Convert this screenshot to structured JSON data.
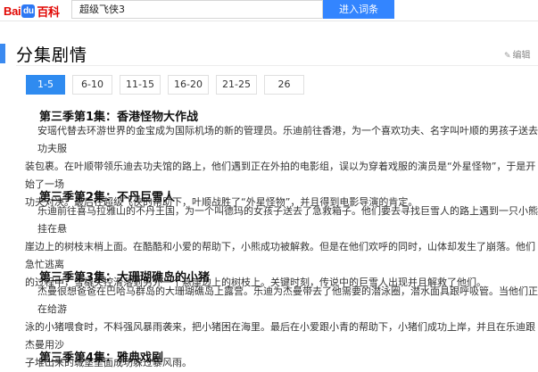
{
  "topbar": {
    "logo_bai": "Bai",
    "logo_paw": "du",
    "logo_baike": "百科",
    "search_value": "超级飞侠3",
    "search_button": "进入词条"
  },
  "section": {
    "title": "分集剧情",
    "edit_label": "编辑"
  },
  "tabs": [
    {
      "label": "1-5",
      "active": true
    },
    {
      "label": "6-10",
      "active": false
    },
    {
      "label": "11-15",
      "active": false
    },
    {
      "label": "16-20",
      "active": false
    },
    {
      "label": "21-25",
      "active": false
    },
    {
      "label": "26",
      "active": false
    }
  ],
  "episodes": [
    {
      "title": "第三季第1集：香港怪物大作战",
      "lines": [
        "安瑶代替去环游世界的金宝成为国际机场的新的管理员。乐迪前往香港，为一个喜欢功夫、名字叫叶顺的男孩子送去功夫服",
        "装包裹。在叶顺带领乐迪去功夫馆的路上，他们遇到正在外拍的电影组，误以为穿着戏服的演员是“外星怪物”，于是开始了一场",
        "功夫对决。最后在超级飞侠的帮助下，叶顺战胜了“外星怪物”，并且得到电影导演的肯定。"
      ]
    },
    {
      "title": "第三季第2集：不丹巨雪人",
      "lines": [
        "乐迪前往喜马拉雅山的不丹王国，为一个叫德玛的女孩子送去了急救箱子。他们要去寻找巨雪人的路上遇到一只小熊挂在悬",
        "崖边上的树枝末梢上面。在酷酷和小爱的帮助下，小熊成功被解救。但是在他们欢呼的同时，山体却发生了崩落。他们急忙逃离",
        "的过程中，雪橇失控滑落到另外一个悬崖边上的树枝上。关键时刻，传说中的巨雪人出现并且解救了他们。"
      ]
    },
    {
      "title": "第三季第3集：大珊瑚礁岛的小猪",
      "lines": [
        "杰曼很想爸爸在巴哈马群岛的大珊瑚礁岛上露营。乐迪为杰曼带去了他需要的潜泳圈，潜水面具跟呼吸管。当他们正在给游",
        "泳的小猪喂食时，不料强风暴雨袭来，把小猪困在海里。最后在小爱跟小青的帮助下，小猪们成功上岸，并且在乐迪跟杰曼用沙",
        "子堆出来的城堡里面成功躲过暴风雨。"
      ]
    },
    {
      "title": "第三季第4集：雅典戏剧",
      "lines": []
    }
  ]
}
